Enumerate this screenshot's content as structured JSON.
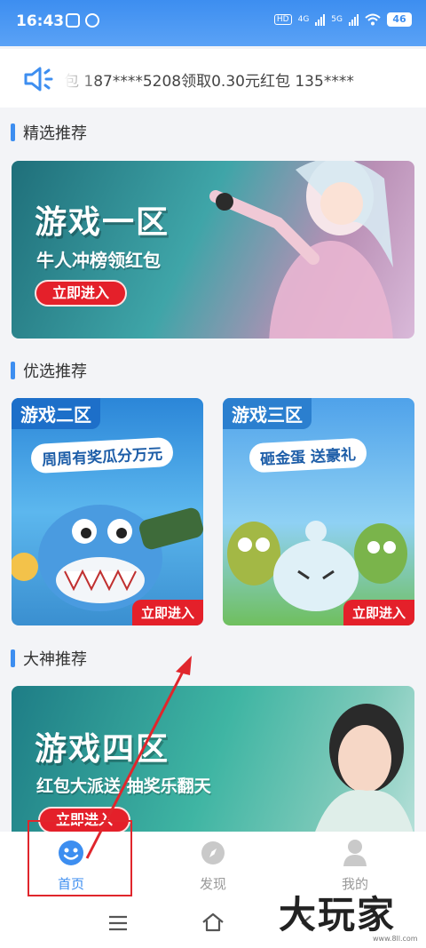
{
  "status": {
    "time": "16:43",
    "network_hd": "HD",
    "network_4g": "4G",
    "network_5g": "5G",
    "battery": "46"
  },
  "marquee": {
    "text": "包   187****5208领取0.30元红包    135****"
  },
  "sections": {
    "featured": "精选推荐",
    "preferred": "优选推荐",
    "master": "大神推荐"
  },
  "banners": {
    "zone1": {
      "title": "游戏一区",
      "subtitle": "牛人冲榜领红包",
      "button": "立即进入"
    },
    "zone2": {
      "tag": "游戏二区",
      "slogan": "周周有奖瓜分万元",
      "button": "立即进入"
    },
    "zone3": {
      "tag": "游戏三区",
      "slogan": "砸金蛋 送豪礼",
      "button": "立即进入"
    },
    "zone4": {
      "title": "游戏四区",
      "subtitle": "红包大派送  抽奖乐翻天",
      "button": "立即进入"
    }
  },
  "tabs": [
    {
      "label": "首页",
      "icon": "smile-home-icon",
      "active": true
    },
    {
      "label": "发现",
      "icon": "compass-icon",
      "active": false
    },
    {
      "label": "我的",
      "icon": "user-icon",
      "active": false
    }
  ],
  "watermark": {
    "text": "大玩家",
    "url": "www.8ll.com"
  },
  "colors": {
    "accent": "#3d8ef0",
    "button_red": "#e4202a",
    "annotation_red": "#e0262c"
  }
}
